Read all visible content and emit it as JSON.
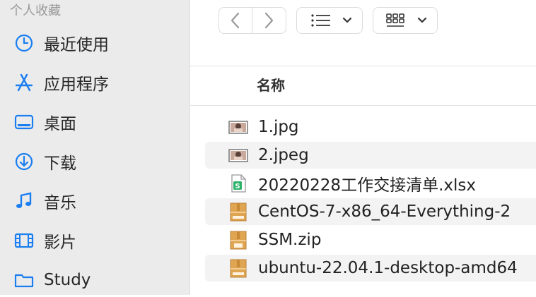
{
  "sidebar": {
    "heading": "个人收藏",
    "items": [
      {
        "label": "最近使用",
        "icon": "clock-icon"
      },
      {
        "label": "应用程序",
        "icon": "applications-icon"
      },
      {
        "label": "桌面",
        "icon": "desktop-icon"
      },
      {
        "label": "下载",
        "icon": "download-icon"
      },
      {
        "label": "音乐",
        "icon": "music-note-icon"
      },
      {
        "label": "影片",
        "icon": "film-icon"
      },
      {
        "label": "Study",
        "icon": "folder-icon"
      }
    ]
  },
  "toolbar": {
    "back_icon": "chevron-left-icon",
    "forward_icon": "chevron-right-icon",
    "list_view_icon": "list-view-icon",
    "grid_view_icon": "grid-view-icon"
  },
  "file_list": {
    "column_name": "名称",
    "files": [
      {
        "name": "1.jpg",
        "type": "image"
      },
      {
        "name": "2.jpeg",
        "type": "image"
      },
      {
        "name": "20220228工作交接清单.xlsx",
        "type": "spreadsheet"
      },
      {
        "name": "CentOS-7-x86_64-Everything-2",
        "type": "archive"
      },
      {
        "name": "SSM.zip",
        "type": "zip"
      },
      {
        "name": "ubuntu-22.04.1-desktop-amd64",
        "type": "archive"
      }
    ]
  },
  "colors": {
    "sidebar_bg": "#ebebeb",
    "accent": "#1a7ef0",
    "row_alt": "#f3f3f3"
  }
}
